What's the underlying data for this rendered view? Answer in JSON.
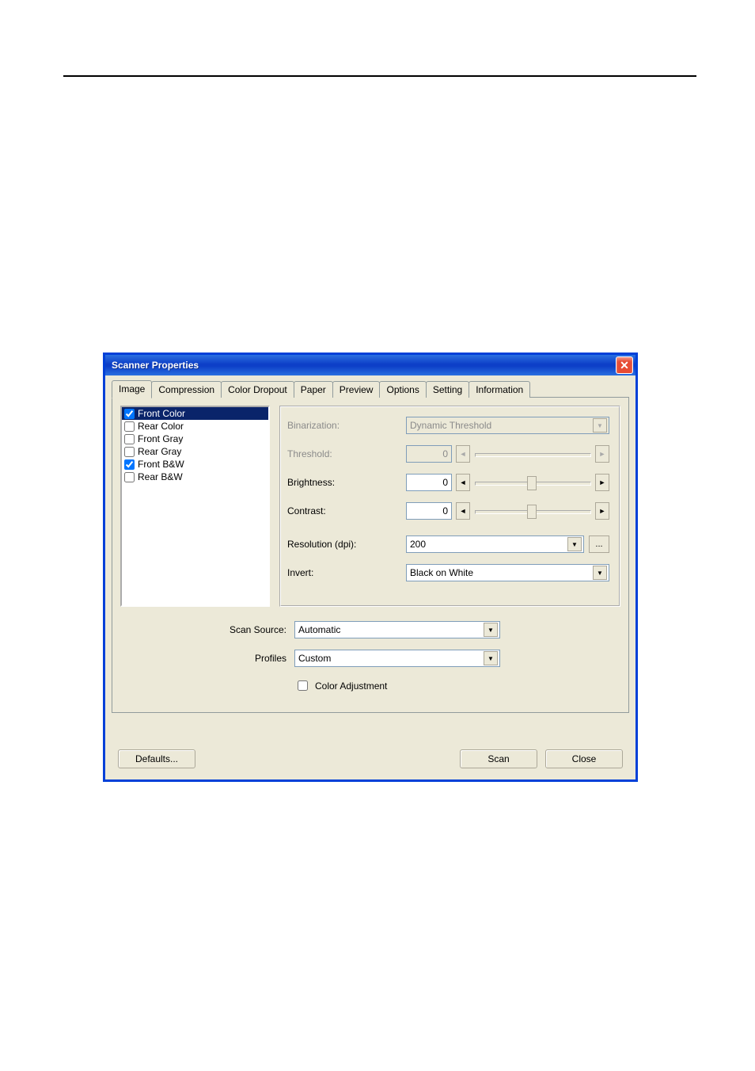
{
  "window": {
    "title": "Scanner Properties"
  },
  "tabs": [
    {
      "label": "Image",
      "active": true
    },
    {
      "label": "Compression",
      "active": false
    },
    {
      "label": "Color Dropout",
      "active": false
    },
    {
      "label": "Paper",
      "active": false
    },
    {
      "label": "Preview",
      "active": false
    },
    {
      "label": "Options",
      "active": false
    },
    {
      "label": "Setting",
      "active": false
    },
    {
      "label": "Information",
      "active": false
    }
  ],
  "image_selection": [
    {
      "label": "Front Color",
      "checked": true,
      "selected": true
    },
    {
      "label": "Rear Color",
      "checked": false,
      "selected": false
    },
    {
      "label": "Front Gray",
      "checked": false,
      "selected": false
    },
    {
      "label": "Rear Gray",
      "checked": false,
      "selected": false
    },
    {
      "label": "Front B&W",
      "checked": true,
      "selected": false
    },
    {
      "label": "Rear B&W",
      "checked": false,
      "selected": false
    }
  ],
  "settings": {
    "binarization": {
      "label": "Binarization:",
      "value": "Dynamic Threshold",
      "enabled": false
    },
    "threshold": {
      "label": "Threshold:",
      "value": "0",
      "enabled": false
    },
    "brightness": {
      "label": "Brightness:",
      "value": "0",
      "enabled": true
    },
    "contrast": {
      "label": "Contrast:",
      "value": "0",
      "enabled": true
    },
    "resolution": {
      "label": "Resolution (dpi):",
      "value": "200",
      "enabled": true
    },
    "invert": {
      "label": "Invert:",
      "value": "Black on White",
      "enabled": true
    }
  },
  "lower": {
    "scan_source": {
      "label": "Scan Source:",
      "value": "Automatic"
    },
    "profiles": {
      "label": "Profiles",
      "value": "Custom"
    },
    "color_adjustment": {
      "label": "Color Adjustment",
      "checked": false
    }
  },
  "buttons": {
    "defaults": "Defaults...",
    "scan": "Scan",
    "close": "Close",
    "ellipsis": "..."
  },
  "glyphs": {
    "down": "▼",
    "left": "◄",
    "right": "►",
    "close": "✕"
  }
}
